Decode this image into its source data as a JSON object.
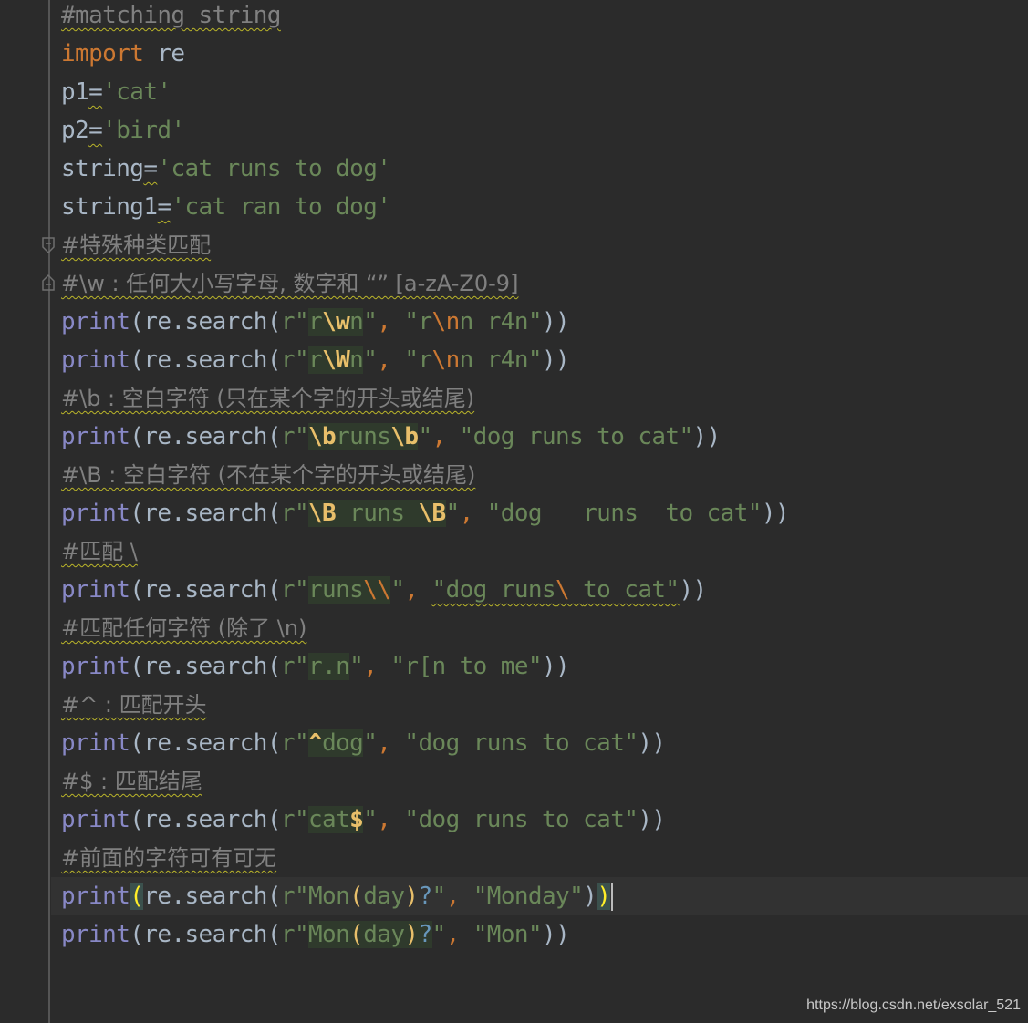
{
  "editor": {
    "lines": [
      {
        "type": "comment",
        "text": "#matching string"
      },
      {
        "type": "import",
        "keyword": "import",
        "module": "re"
      },
      {
        "type": "assign",
        "name": "p1",
        "value": "'cat'"
      },
      {
        "type": "assign",
        "name": "p2",
        "value": "'bird'"
      },
      {
        "type": "assign",
        "name": "string",
        "value": "'cat runs to dog'"
      },
      {
        "type": "assign",
        "name": "string1",
        "value": "'cat ran to dog'"
      },
      {
        "type": "comment",
        "text": "#特殊种类匹配"
      },
      {
        "type": "comment",
        "text": "#\\w : 任何大小写字母, 数字和 “” [a-zA-Z0-9]"
      },
      {
        "type": "call",
        "pattern": "r\\wn",
        "target": "\"r\\nn r4n\""
      },
      {
        "type": "call",
        "pattern": "r\\Wn",
        "target": "\"r\\nn r4n\""
      },
      {
        "type": "comment",
        "text": "#\\b : 空白字符 (只在某个字的开头或结尾)"
      },
      {
        "type": "call",
        "pattern": "\\bruns\\b",
        "target": "\"dog runs to cat\""
      },
      {
        "type": "comment",
        "text": "#\\B : 空白字符 (不在某个字的开头或结尾)"
      },
      {
        "type": "call",
        "pattern": "\\B runs \\B",
        "target": "\"dog   runs  to cat\""
      },
      {
        "type": "comment",
        "text": "#匹配 \\"
      },
      {
        "type": "call",
        "pattern": "runs\\\\",
        "target": "\"dog runs\\ to cat\""
      },
      {
        "type": "comment",
        "text": "#匹配任何字符 (除了 \\n)"
      },
      {
        "type": "call",
        "pattern": "r.n",
        "target": "\"r[n to me\""
      },
      {
        "type": "comment",
        "text": "#^ : 匹配开头"
      },
      {
        "type": "call",
        "pattern": "^dog",
        "target": "\"dog runs to cat\""
      },
      {
        "type": "comment",
        "text": "#$ : 匹配结尾"
      },
      {
        "type": "call",
        "pattern": "cat$",
        "target": "\"dog runs to cat\""
      },
      {
        "type": "comment",
        "text": "#前面的字符可有可无"
      },
      {
        "type": "call",
        "pattern": "Mon(day)?",
        "target": "\"Monday\"",
        "current": true
      },
      {
        "type": "call",
        "pattern": "Mon(day)?",
        "target": "\"Mon\""
      }
    ],
    "tokens": {
      "print": "print",
      "re_search": "re.search",
      "raw_prefix": "r\"",
      "quote": "\"",
      "comma": ", ",
      "open": "(",
      "close": ")",
      "eq": "="
    }
  },
  "colors": {
    "background": "#2b2b2b",
    "comment": "#808080",
    "keyword": "#cc7832",
    "builtin": "#8888c6",
    "string": "#6a8759",
    "regex_escape": "#e8bf6a",
    "identifier": "#a9b7c6"
  },
  "watermark": "https://blog.csdn.net/exsolar_521"
}
